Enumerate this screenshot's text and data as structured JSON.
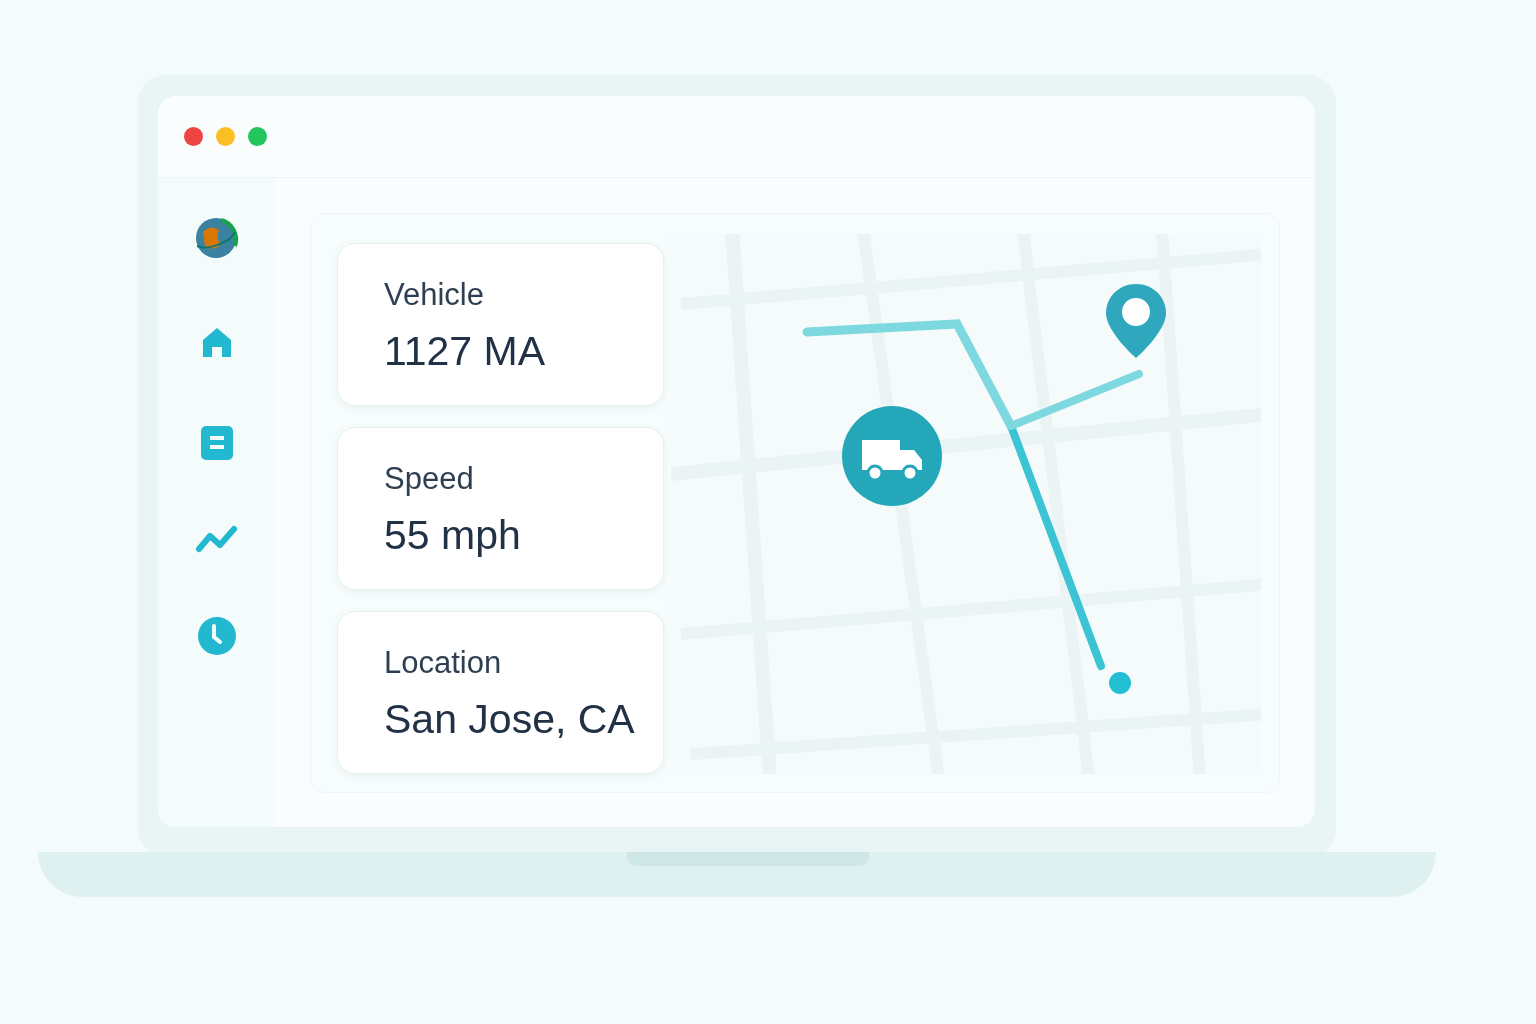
{
  "cards": [
    {
      "label": "Vehicle",
      "value": "1127 MA"
    },
    {
      "label": "Speed",
      "value": "55 mph"
    },
    {
      "label": "Location",
      "value": "San Jose, CA"
    }
  ]
}
